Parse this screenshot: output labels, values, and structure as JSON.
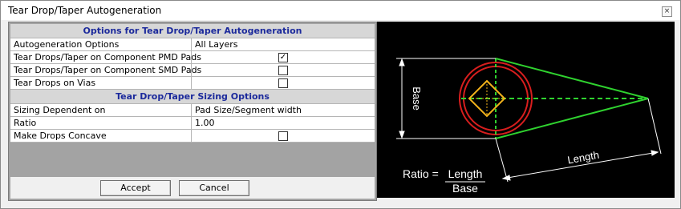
{
  "window": {
    "title": "Tear Drop/Taper Autogeneration",
    "close_symbol": "×"
  },
  "section1": {
    "header": "Options for Tear Drop/Taper Autogeneration",
    "rows": [
      {
        "label": "Autogeneration Options",
        "value": "All Layers"
      },
      {
        "label": "Tear Drops/Taper on Component PMD Pads",
        "checked": true
      },
      {
        "label": "Tear Drops/Taper on Component SMD Pads",
        "checked": false
      },
      {
        "label": "Tear Drops on Vias",
        "checked": false
      }
    ]
  },
  "section2": {
    "header": "Tear Drop/Taper Sizing Options",
    "rows": [
      {
        "label": "Sizing Dependent on",
        "value": "Pad Size/Segment width"
      },
      {
        "label": "Ratio",
        "value": "1.00"
      },
      {
        "label": "Make Drops Concave",
        "checked": false
      }
    ]
  },
  "buttons": {
    "accept": "Accept",
    "cancel": "Cancel"
  },
  "checkmark_symbol": "✓",
  "diagram": {
    "base_label": "Base",
    "length_label": "Length",
    "ratio_prefix": "Ratio =",
    "ratio_numerator": "Length",
    "ratio_denominator": "Base",
    "colors": {
      "circle": "#d81e1e",
      "pad": "#f2b21b",
      "taper": "#2fd22f",
      "dimension": "#ffffff"
    }
  }
}
